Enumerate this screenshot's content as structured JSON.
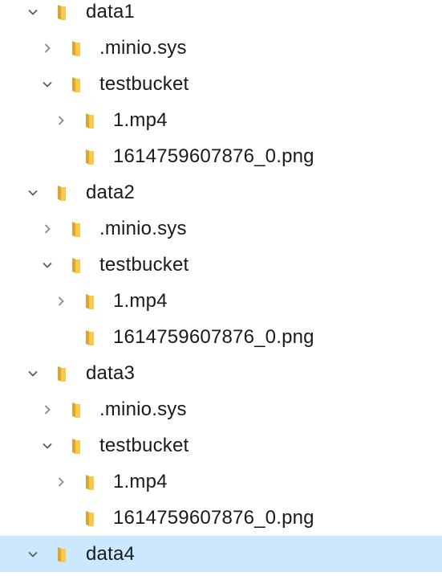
{
  "tree": [
    {
      "label": "data1",
      "expanded": true,
      "children": [
        {
          "label": ".minio.sys",
          "expanded": false
        },
        {
          "label": "testbucket",
          "expanded": true,
          "children": [
            {
              "label": "1.mp4",
              "expanded": false
            },
            {
              "label": "1614759607876_0.png",
              "leaf": true
            }
          ]
        }
      ]
    },
    {
      "label": "data2",
      "expanded": true,
      "children": [
        {
          "label": ".minio.sys",
          "expanded": false
        },
        {
          "label": "testbucket",
          "expanded": true,
          "children": [
            {
              "label": "1.mp4",
              "expanded": false
            },
            {
              "label": "1614759607876_0.png",
              "leaf": true
            }
          ]
        }
      ]
    },
    {
      "label": "data3",
      "expanded": true,
      "children": [
        {
          "label": ".minio.sys",
          "expanded": false
        },
        {
          "label": "testbucket",
          "expanded": true,
          "children": [
            {
              "label": "1.mp4",
              "expanded": false
            },
            {
              "label": "1614759607876_0.png",
              "leaf": true
            }
          ]
        }
      ]
    },
    {
      "label": "data4",
      "expanded": true,
      "selected": true
    }
  ],
  "icons": {
    "folder": "folder-icon",
    "expanded": "chevron-down-icon",
    "collapsed": "chevron-right-icon"
  },
  "colors": {
    "selection": "#cce8ff",
    "folder": "#f8c94b",
    "chevron": "#5c5c5c"
  }
}
